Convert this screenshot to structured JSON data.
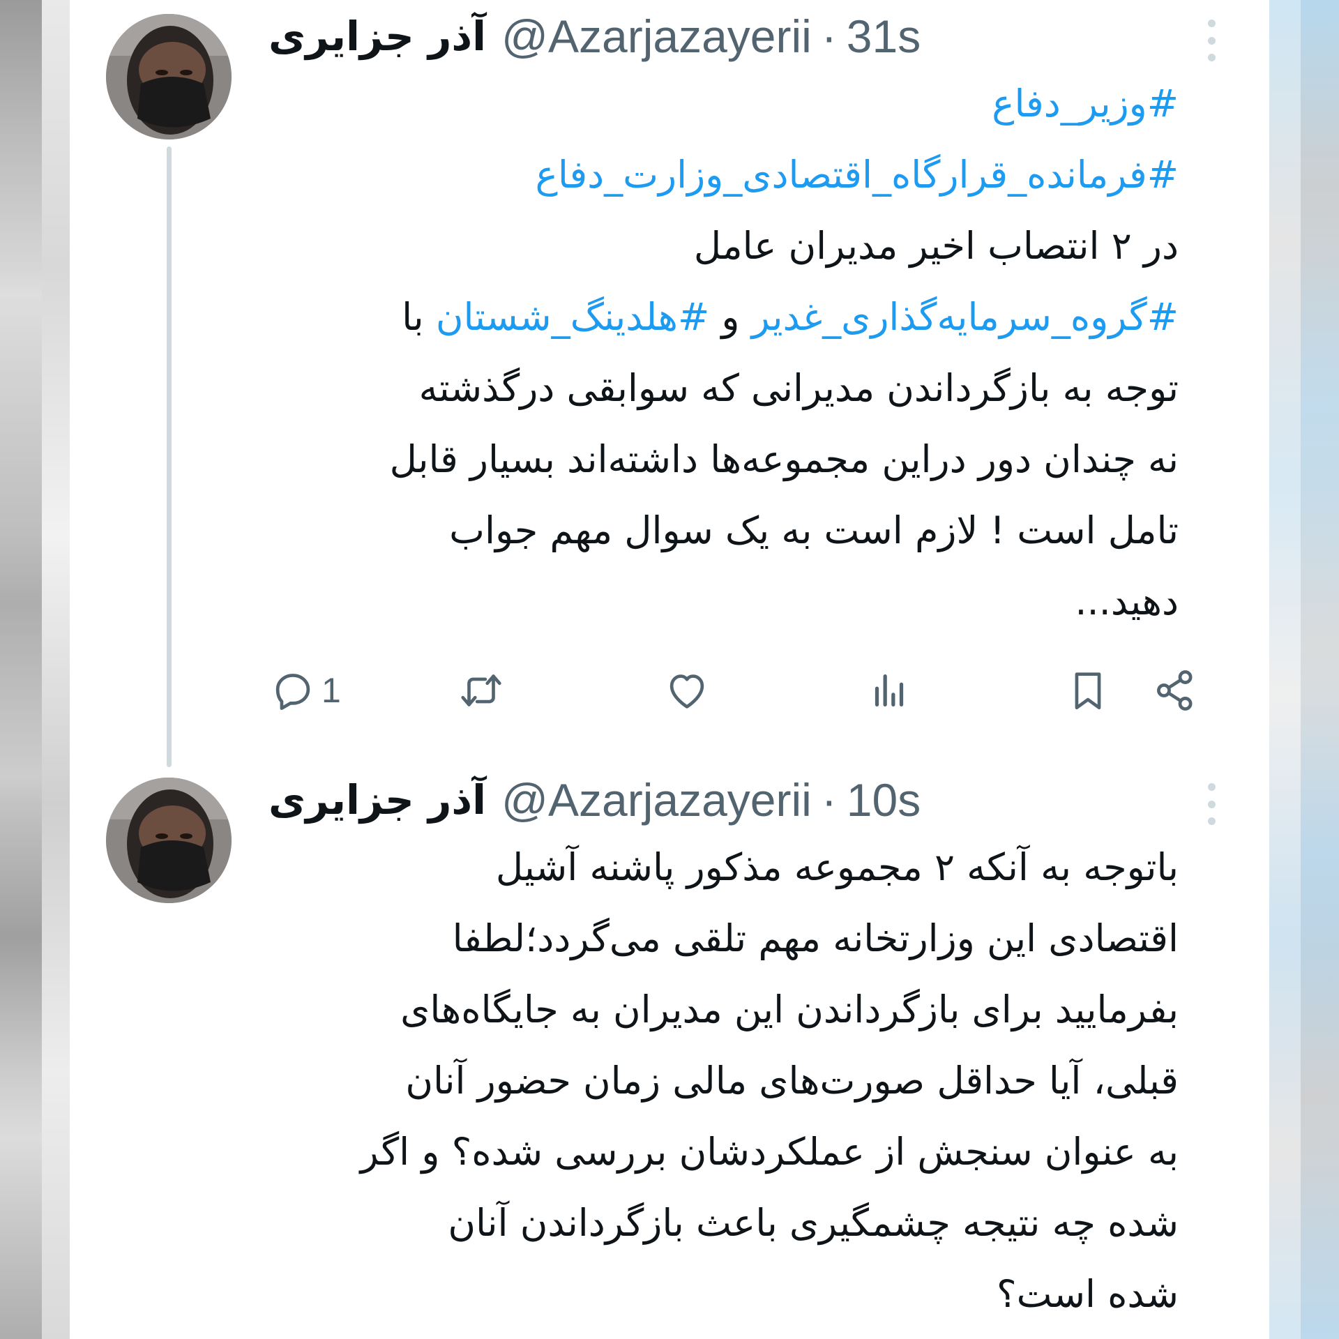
{
  "tweets": [
    {
      "display_name": "آذر جزایری",
      "handle": "@Azarjazayerii",
      "separator": "·",
      "time": "31s",
      "lines": [
        {
          "text": "#وزیر_دفاع",
          "hashtag": true
        },
        {
          "text": "#فرمانده_قرارگاه_اقتصادی_وزارت_دفاع",
          "hashtag": true
        },
        {
          "text": "در ۲ انتصاب اخیر مدیران عامل",
          "hashtag": false
        }
      ],
      "mixed_line": {
        "tag1": "#گروه_سرمایه‌گذاری_غدیر",
        "connector": " و ",
        "tag2": "#هلدینگ_شستان",
        "tail": " با"
      },
      "lines_after": [
        "توجه به بازگرداندن مدیرانی که سوابقی درگذشته",
        "نه چندان دور دراین مجموعه‌ها داشته‌اند بسیار قابل",
        "تامل است ! لازم است به یک سوال مهم جواب",
        "دهید..."
      ],
      "actions": {
        "reply_count": "1"
      }
    },
    {
      "display_name": "آذر جزایری",
      "handle": "@Azarjazayerii",
      "separator": "·",
      "time": "10s",
      "lines_after": [
        "باتوجه به آنکه ۲ مجموعه مذکور پاشنه آشیل",
        "اقتصادی این وزارتخانه مهم تلقی می‌گردد؛لطفا",
        "بفرمایید برای بازگرداندن این مدیران به جایگاه‌های",
        "قبلی، آیا حداقل صورت‌های مالی زمان حضور آنان",
        "به عنوان سنجش از عملکردشان بررسی شده؟ و اگر",
        "شده چه نتیجه چشمگیری باعث بازگرداندن آنان",
        "شده است؟"
      ]
    }
  ],
  "icons": [
    "reply-icon",
    "retweet-icon",
    "like-icon",
    "views-icon",
    "bookmark-icon",
    "share-icon",
    "more-icon"
  ],
  "colors": {
    "hashtag": "#1d9bf0",
    "text": "#0f1419",
    "secondary": "#536471",
    "thread_line": "#cfd9de"
  }
}
